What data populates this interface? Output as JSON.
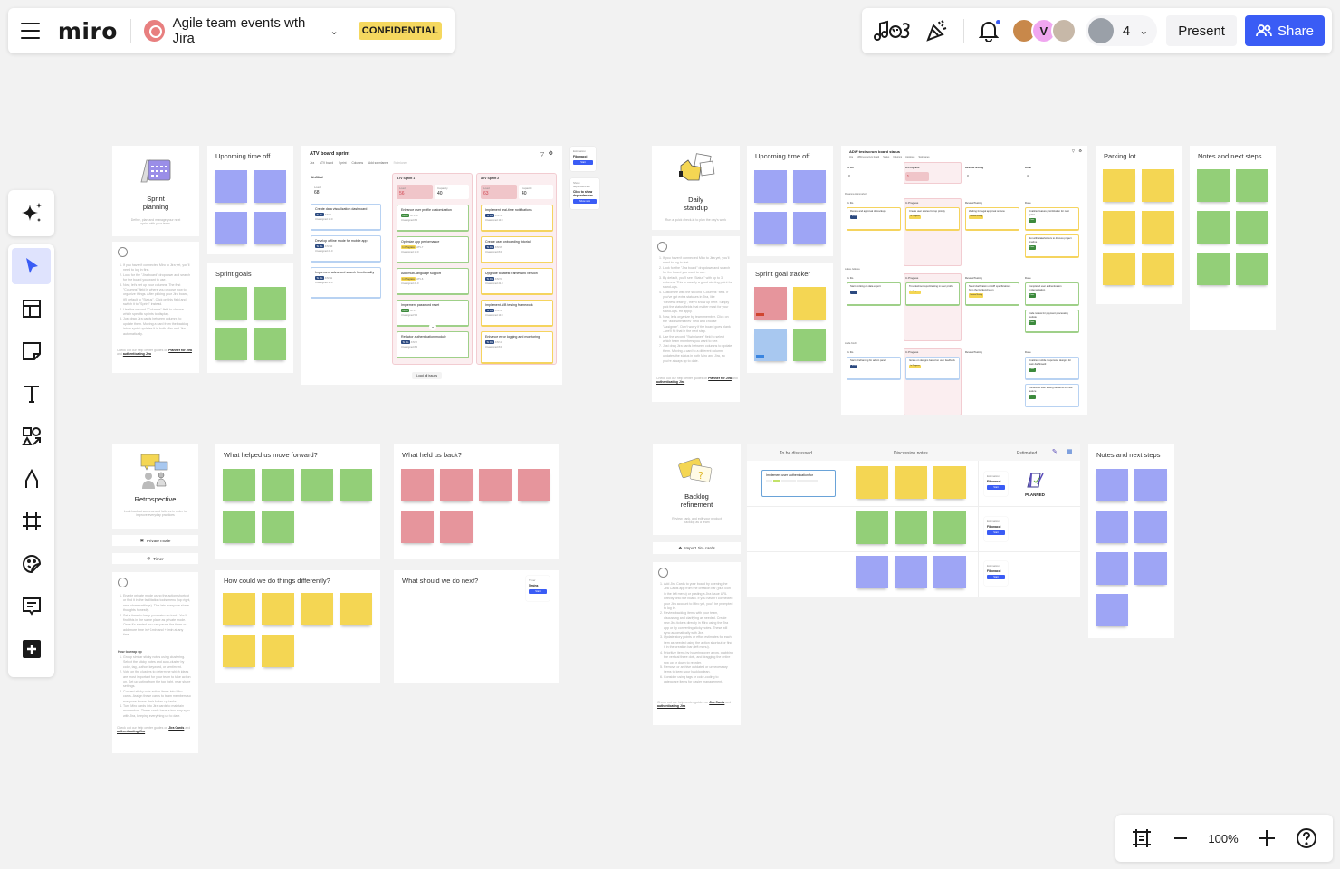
{
  "header": {
    "logo": "miro",
    "board_title": "Agile team events wth Jira",
    "badge": "CONFIDENTIAL",
    "collaborator_count": "4",
    "avatar_initial": "V",
    "present_label": "Present",
    "share_label": "Share",
    "colors": {
      "accent": "#3a5cf5",
      "badge": "#f5d85f"
    }
  },
  "toolbar": {
    "items": [
      {
        "name": "select",
        "icon": "cursor-icon",
        "active": true
      },
      {
        "name": "templates",
        "icon": "templates-icon"
      },
      {
        "name": "sticky-note",
        "icon": "sticky-note-icon"
      },
      {
        "name": "text",
        "icon": "text-icon"
      },
      {
        "name": "shapes",
        "icon": "shapes-icon"
      },
      {
        "name": "pen",
        "icon": "pen-icon"
      },
      {
        "name": "frame",
        "icon": "frame-icon"
      },
      {
        "name": "stickers",
        "icon": "sticker-icon"
      },
      {
        "name": "comment",
        "icon": "comment-icon"
      },
      {
        "name": "more",
        "icon": "plus-icon"
      }
    ]
  },
  "zoom": {
    "value": "100%"
  },
  "sprint_planning": {
    "title": "Sprint planning",
    "subtitle": "Define, plan and manage your next sprint with your team.",
    "instructions": [
      "If you haven't connected Miro to Jira yet, you'll need to log in first.",
      "Look for the \"Jira board\" dropdown and search for the board you want to use.",
      "Now, let's set up your columns. The first \"Columns\" field is where you choose how to organize things. After picking your Jira board, it'll default to \"Status\". Click on this field and switch it to \"Sprint\" instead.",
      "Use the second \"Columns\" field to choose which specific sprints to display.",
      "Just drag Jira cards between columns to update them. Moving a card from the backlog into a sprint updates it in both Miro and Jira automatically."
    ],
    "help_prefix": "Check out our help center guides on",
    "help_link1": "Planner for Jira",
    "help_and": "and",
    "help_link2": "authenticating Jira",
    "upcoming_title": "Upcoming time off",
    "goals_title": "Sprint goals"
  },
  "atv_board": {
    "title": "ATV board sprint",
    "filters": [
      "Jira",
      "ATV board",
      "Sprint",
      "Columns",
      "Add swimlanes",
      "Swimlanes"
    ],
    "columns": [
      {
        "name": "Unfilted",
        "load_label": "Load",
        "load": "68",
        "cards": [
          {
            "title": "Create data visualization dashboard",
            "status": "To Do",
            "key": "ATV-9",
            "assignee": "Unassigned",
            "points": "13.0"
          },
          {
            "title": "Develop offline mode for mobile app",
            "status": "To Do",
            "key": "ATV-10",
            "assignee": "Unassigned",
            "points": "21.0"
          },
          {
            "title": "Implement advanced search functionality",
            "status": "To Do",
            "key": "ATV-11",
            "assignee": "Unassigned",
            "points": "34.0"
          }
        ]
      },
      {
        "name": "ATV Sprint 1",
        "load_label": "Load",
        "load": "56",
        "capacity_label": "Capacity",
        "capacity": "40",
        "cards": [
          {
            "title": "Enhance user profile customization",
            "status": "Done",
            "key": "ATV-12",
            "assignee": "Unassigned",
            "points": "8.0"
          },
          {
            "title": "Optimize app performance",
            "status": "In Progress",
            "key": "ATV-7",
            "assignee": "Unassigned",
            "points": "13.0"
          },
          {
            "title": "Add multi-language support",
            "status": "In Progress",
            "key": "ATV-6",
            "assignee": "Unassigned",
            "points": "21.0"
          },
          {
            "title": "Implement password reset",
            "status": "Done",
            "key": "ATV-1",
            "assignee": "Unassigned",
            "points": "5.0"
          },
          {
            "title": "Refactor authentication module",
            "status": "To Do",
            "key": "ATV-2",
            "assignee": "Unassigned",
            "points": "8.0"
          }
        ]
      },
      {
        "name": "ATV Sprint 2",
        "load_label": "Load",
        "load": "63",
        "capacity_label": "Capacity",
        "capacity": "40",
        "cards": [
          {
            "title": "Implement real-time notifications",
            "status": "To Do",
            "key": "ATV-13",
            "assignee": "Unassigned",
            "points": "13.0"
          },
          {
            "title": "Create user onboarding tutorial",
            "status": "To Do",
            "key": "ATV-8",
            "assignee": "Unassigned",
            "points": "8.0"
          },
          {
            "title": "Upgrade to latest framework version",
            "status": "To Do",
            "key": "ATV-5",
            "assignee": "Unassigned",
            "points": "21.0"
          },
          {
            "title": "Implement A/B testing framework",
            "status": "To Do",
            "key": "ATV-3",
            "assignee": "Unassigned",
            "points": "13.0"
          },
          {
            "title": "Enhance error logging and monitoring",
            "status": "To Do",
            "key": "ATV-4",
            "assignee": "Unassigned",
            "points": "8.0"
          }
        ]
      }
    ],
    "load_all": "Load all issues",
    "estimation_widget": {
      "label": "Estimation",
      "value": "Fibonacci",
      "button": "Start"
    },
    "dependencies_widget": {
      "label": "Show dependencies",
      "value": "Click to show dependencies",
      "button": "Show now"
    }
  },
  "daily_standup": {
    "title": "Daily standup",
    "subtitle": "Run a quick check-in to plan the day's work",
    "instructions": [
      "If you haven't connected Miro to Jira yet, you'll need to log in first.",
      "Look for the \"Jira board\" dropdown and search for the board you want to use.",
      "By default, you'll see \"Status\" with up to 3 columns. This is usually a good starting point for stand-ups.",
      "Customize with the second \"Columns\" field. If you've got extra statuses in Jira, like \"Review/Testing\", they'll show up here. Simply pick the status fields that matter most for your stand-ups. Hit apply.",
      "Now, let's organize by team member. Click on the \"add swimlanes\" field and choose \"Assignee\". Don't worry if the board goes blank – we'll fix that in the next step.",
      "Use the second \"Swimlanes\" field to select which team members you want to see.",
      "Just drag Jira cards between columns to update them. Moving a card to a different column updates the status in both Miro and Jira, so you're always up to date."
    ],
    "help_prefix": "Check out our help center guides on",
    "help_link1": "Planner for Jira",
    "help_and": "and",
    "help_link2": "authenticating Jira",
    "upcoming_title": "Upcoming time off",
    "tracker_title": "Sprint goal tracker"
  },
  "scrum_board": {
    "title": "ADW test scrum board status",
    "filters": [
      "Jira",
      "ADW test scrum board",
      "Status",
      "Columns",
      "Assignee",
      "Swimlanes"
    ],
    "columns": [
      "To Do",
      "In Progress",
      "Review/Testing",
      "Done"
    ],
    "summary": [
      {
        "load": "3"
      },
      {
        "load": "5",
        "capacity": "5"
      },
      {
        "load": "3"
      },
      {
        "load": "4"
      }
    ],
    "lanes": [
      {
        "name": "Rosanna Hummelvoll",
        "cards": [
          {
            "col": 0,
            "title": "Review and approval of mockups",
            "status": "To Do"
          },
          {
            "col": 1,
            "title": "Create user stories for top priority",
            "status": "In Progress"
          },
          {
            "col": 2,
            "title": "Waiting for legal approval on new",
            "status": "Review/Testing"
          },
          {
            "col": 3,
            "title": "Finalized feature prioritization for next sprint",
            "status": "Done"
          },
          {
            "col": 3,
            "title": "Met with stakeholders to discuss project timeline",
            "status": "Done"
          }
        ]
      },
      {
        "name": "Lukas Jellema",
        "cards": [
          {
            "col": 0,
            "title": "Start working on data export",
            "status": "To Do"
          },
          {
            "col": 1,
            "title": "Troubleshoot report/testing in user profile",
            "status": "In Progress"
          },
          {
            "col": 2,
            "title": "Need clarification on API specifications from the backend team",
            "status": "Review/Testing"
          },
          {
            "col": 3,
            "title": "Completed user authentication implementation",
            "status": "Done"
          },
          {
            "col": 3,
            "title": "Code review for payment processing module",
            "status": "Done"
          }
        ]
      },
      {
        "name": "Linda Koch",
        "cards": [
          {
            "col": 0,
            "title": "Start wireframing for admin panel",
            "status": "To Do"
          },
          {
            "col": 1,
            "title": "Iterate on designs based on user feedback",
            "status": "In Progress"
          },
          {
            "col": 3,
            "title": "Finalized mobile responsive designs for main dashboard",
            "status": "Done"
          },
          {
            "col": 3,
            "title": "Conducted user testing sessions for new feature",
            "status": "Done"
          }
        ]
      }
    ]
  },
  "parking_lot": {
    "title": "Parking lot"
  },
  "notes_next_steps_1": {
    "title": "Notes and next steps"
  },
  "retrospective": {
    "title": "Retrospective",
    "subtitle": "Look back at success and failures in order to improve everyday practices",
    "private_mode": "Private mode",
    "timer": "Timer",
    "instructions": [
      "Enable private mode using the action shortcut or find it in the facilitation tools menu (top right, near share settings). This lets everyone share thoughts honestly.",
      "Set a timer to keep your retro on track. You'll find this in the same place as private mode. Once it's started you can pause the timer or add more time in +1min and +5min at any time."
    ],
    "wrap_title": "How to wrap up",
    "wrap_steps": [
      "Group similar sticky notes using clustering. Select the sticky notes and auto-cluster by color, tag, author, keyword, or sentiment.",
      "Vote on the clusters to determine which ideas are most important for your team to take action on. Set up voting from the top right, near share settings.",
      "Convert sticky note action items into Miro cards. Assign these cards to team members so everyone knows their follow-up tasks.",
      "Turn Miro cards into Jira cards to maintain momentum. These cards have a two-way sync with Jira, keeping everything up to date."
    ],
    "help_prefix": "Check out our help center guides on",
    "help_link1": "Jira Cards",
    "help_and": "and",
    "help_link2": "authenticating Jira",
    "q1": "What helped us move forward?",
    "q2": "What held us back?",
    "q3": "How could we do things differently?",
    "q4": "What should we do next?",
    "timer_widget": {
      "label": "Timer",
      "value": "5 mins",
      "button": "Start"
    }
  },
  "backlog": {
    "title": "Backlog refinement",
    "subtitle": "Review, rank, and edit your product backlog as a team",
    "import_label": "Import Jira cards",
    "instructions": [
      "Add Jira Cards to your board by opening the Jira Cards app from the creation bar (plus icon in the left menu) or pasting a Jira issue URL directly onto the board. If you haven't connected your Jira account to Miro yet, you'll be prompted to log in.",
      "Review backlog items with your team, discussing and clarifying as needed. Create new Jira tickets directly in Miro using the Jira app or by converting sticky notes. These will sync automatically with Jira.",
      "Update story points or effort estimates for each item as needed using the action shortcut or find it in the creation bar (left menu).",
      "Prioritize items by hovering over a row, grabbing the vertical three dots, and dragging the entire row up or down to reorder.",
      "Remove or archive outdated or unnecessary items to keep your backlog lean.",
      "Consider using tags or color-coding to categorize items for easier management."
    ],
    "help_prefix": "Check out our help center guides on",
    "help_link1": "Jira Cards",
    "help_and": "and",
    "help_link2": "authenticating Jira",
    "table": {
      "headers": [
        "To be discussed",
        "Discussion notes",
        "Estimated"
      ],
      "row1_card": "Implement user authentication for",
      "estimation_label": "Estimation",
      "estimation_value": "Fibonacci",
      "estimation_button": "Start",
      "planned_sticker": "PLANNED"
    }
  },
  "notes_next_steps_2": {
    "title": "Notes and next steps"
  }
}
